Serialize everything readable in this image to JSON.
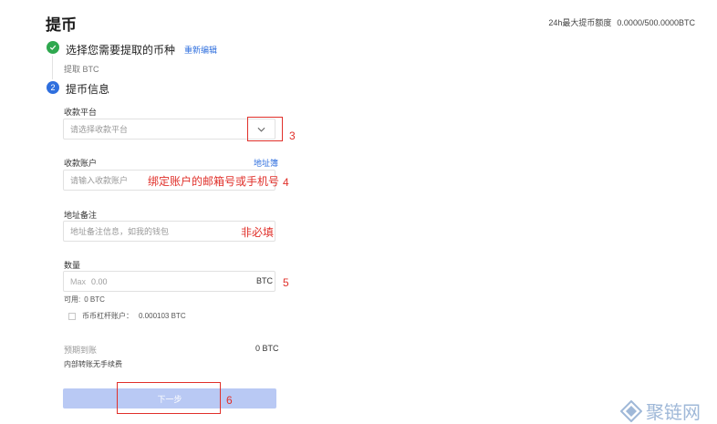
{
  "header": {
    "title": "提币",
    "limit_label": "24h最大提币额度",
    "limit_value": "0.0000/500.0000BTC"
  },
  "steps": {
    "step1": {
      "label": "选择您需要提取的币种",
      "edit": "重新编辑",
      "chosen": "提取 BTC"
    },
    "step2": {
      "number": "2",
      "label": "提币信息"
    }
  },
  "form": {
    "platform": {
      "label": "收款平台",
      "placeholder": "请选择收款平台"
    },
    "account": {
      "label": "收款账户",
      "address_book": "地址簿",
      "placeholder": "请输入收款账户"
    },
    "memo": {
      "label": "地址备注",
      "placeholder": "地址备注信息，如我的钱包"
    },
    "amount": {
      "label": "数量",
      "max": "Max",
      "placeholder": "0.00",
      "unit": "BTC"
    },
    "available": {
      "label": "可用:",
      "value": "0 BTC"
    },
    "margin_account": {
      "label": "币币杠杆账户：",
      "value": "0.000103 BTC"
    },
    "expected": {
      "label": "预期到账",
      "value": "0 BTC"
    },
    "fee_note": "内部转账无手续费",
    "next_button": "下一步"
  },
  "annotations": {
    "n3": "3",
    "n4": "4",
    "n5": "5",
    "n6": "6",
    "account_hint": "绑定账户的邮箱号或手机号",
    "memo_hint": "非必填"
  },
  "watermark": {
    "text": "聚链网"
  },
  "colors": {
    "accent": "#2f6fde",
    "success": "#2fa84f",
    "button_disabled": "#b9c9f4",
    "annotation": "#e0302a"
  }
}
